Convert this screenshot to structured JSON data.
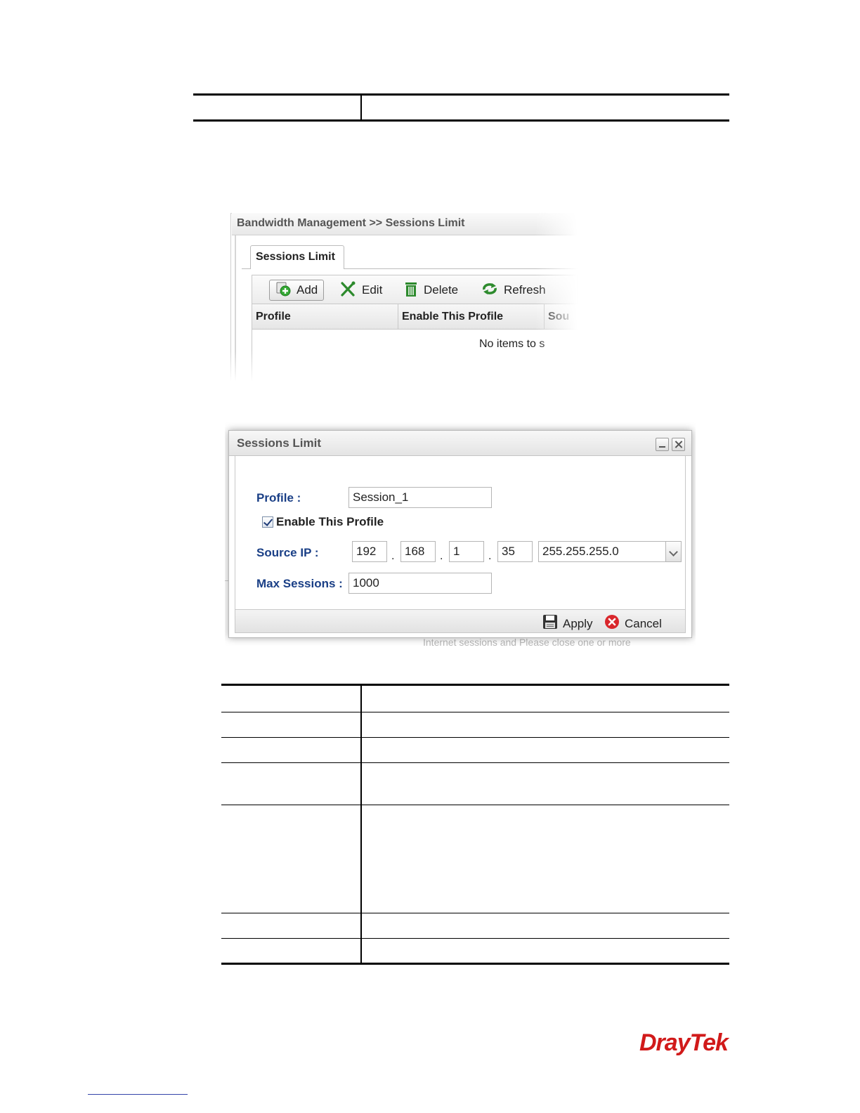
{
  "page_screenshot": {
    "breadcrumb": "Bandwidth Management >> Sessions Limit",
    "tab_label": "Sessions Limit",
    "toolbar": {
      "add": "Add",
      "edit": "Edit",
      "delete": "Delete",
      "refresh": "Refresh"
    },
    "columns": [
      "Profile",
      "Enable This Profile",
      "Sou"
    ],
    "empty_message": "No items to s"
  },
  "dialog": {
    "title": "Sessions Limit",
    "profile_label": "Profile :",
    "profile_value": "Session_1",
    "enable_label": "Enable This Profile",
    "enable_checked": true,
    "source_ip_label": "Source IP :",
    "ip_octets": [
      "192",
      "168",
      "1",
      "35"
    ],
    "ip_separator": ".",
    "subnet_mask": "255.255.255.0",
    "max_sessions_label": "Max Sessions :",
    "max_sessions_value": "1000",
    "apply_label": "Apply",
    "cancel_label": "Cancel",
    "background_text": "Internet sessions and Please close one or more"
  },
  "logo": {
    "brand": "DrayTek",
    "color": "#d11a1a"
  },
  "colors": {
    "label_blue": "#1a3f86",
    "cancel_red": "#d9262b",
    "refresh_green": "#2e8b2e"
  }
}
